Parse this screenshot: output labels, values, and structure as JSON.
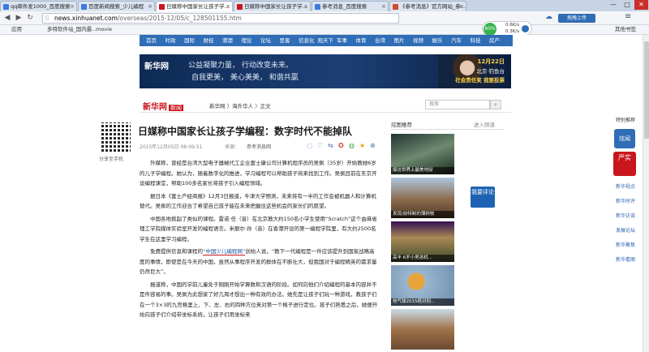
{
  "tabs": [
    {
      "title": "qq邮件发1000_百度搜索"
    },
    {
      "title": "百度新闻搜索_少儿编程"
    },
    {
      "title": "日媒称中国家长让孩子学..."
    },
    {
      "title": "日媒称中国家长让孩子学..."
    },
    {
      "title": "参考消息_百度搜索"
    },
    {
      "title": "《参考消息》官方网站_参..."
    }
  ],
  "window": {
    "minimize": "—",
    "restore": "□",
    "close": "✕",
    "right_action": "拖拽上传"
  },
  "address": {
    "host": "news.xinhuanet.com",
    "path": "/overseas/2015-12/05/c_128501155.htm"
  },
  "bookmarks": [
    {
      "label": "应用"
    },
    {
      "label": "多特软件站_国内最..."
    },
    {
      "label": "movie"
    },
    {
      "label": "其他书签"
    }
  ],
  "gadget": {
    "percent": "60%",
    "up": "0.6K/s",
    "down": "0.3K/s"
  },
  "topnav": [
    "首页",
    "时政",
    "国际",
    "财经",
    "港澳",
    "理论",
    "论坛",
    "思客",
    "信息化",
    "观天下",
    "军事",
    "体育",
    "台湾",
    "图片",
    "视频",
    "娱乐",
    "汽车",
    "科技",
    "房产"
  ],
  "banner": {
    "logo": "新华网",
    "slogan1": "公益凝聚力量， 行动改变未来。",
    "slogan2": "自我更美， 美心美美， 和谐共赢",
    "date": "12月22日",
    "loc": "北京·钓鱼台",
    "cta": "社会责任奖 我要投票"
  },
  "site": {
    "logo": "新华网",
    "logo_sub": "新闻"
  },
  "breadcrumb": "新华网 〉海外华人 〉正文",
  "search": {
    "placeholder": "搜索"
  },
  "qr": {
    "label": "分享至手机"
  },
  "article": {
    "title": "日媒称中国家长让孩子学编程：数字时代不能掉队",
    "datetime": "2015年12月05日 08:09:51",
    "source_label": "来源：",
    "source": "参考消息网",
    "p1": "外媒称，曾经是台湾大型电子器械代工企业富士康公司计算机程序员的吴佩（35岁）开始教她6岁的儿子学编程。她认为，随着数字化的推进，学习编程可以帮助孩子将来找到工作。吴佩目前在东京开设编程课堂，帮助100多名家长将孩子引入编程领域。",
    "p2": "据日本《富士产经商报》12月3日报道，牛津大学预测，未来将有一半的工作会被机器人和计算机替代。吴佩的工作迎合了希望自己孩子能在未来把握住这些机会的家长们的愿望。",
    "p3": "中国各地掀起了类似的课程。雷诺·任（音）在北京教大约150名小学生使用“Scratch”这个由麻省理工学院媒体实验室开发的编程语言。米丽尔·孙（音）在香港开设的第一编程学院里，有大约2500名学生在这里学习编程。",
    "p4a": "免费提供信息和课程的",
    "p4b": "“中国少儿编程网”",
    "p4c": "创始人说，“教下一代编程是一件应该提升到国家战略高度的事情，即使是在今天的中国，虽然从事程序开发的群体在不断壮大，但我国对于编程精英的需求量仍然巨大”。",
    "p5": "报道称，中国的学前儿童处于刚刚开始学算数和汉语的阶段。如何向他们介绍编程的基本内容并不是件容易的事。吴佩为此想家了好几周才想出一种有效的办法。她先是让孩子们玩一种游戏，教孩子们在一个3×3的九宫格里上、下、左、右的四种方位来对第一个格子进行定位。孩子们熟悉之后，她便开始向孩子们介绍带坐标系统，让孩子们用坐标来"
  },
  "share_icons": [
    "comment-icon",
    "heart-icon",
    "share-icon",
    "weibo-icon",
    "wechat-icon",
    "qzone-icon",
    "more-icon"
  ],
  "right": {
    "heading": "炫图推荐",
    "more": "进入频道",
    "vote": "我要评论",
    "thumbs": [
      {
        "caption": "探访世界上最美地狱"
      },
      {
        "caption": "发现/前特制的薄树枝"
      },
      {
        "caption": "高丰 6岁小男孩机..."
      },
      {
        "caption": "热气球2015绝对别..."
      },
      {
        "caption": ""
      }
    ]
  },
  "sidebar": {
    "top": "特别推荐",
    "xh": "炫闻",
    "yan": "严实",
    "links": [
      "新华视点",
      "新华时评",
      "新华访谈",
      "发展论坛",
      "新华聚焦",
      "新华看图"
    ]
  }
}
